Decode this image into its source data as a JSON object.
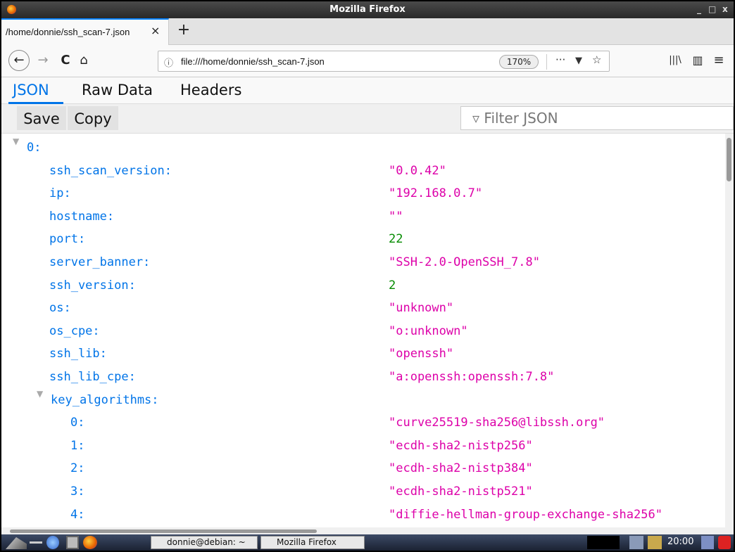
{
  "window": {
    "title": "Mozilla Firefox",
    "controls": [
      "_",
      "□",
      "x"
    ]
  },
  "tab": {
    "label": "/home/donnie/ssh_scan-7.json",
    "close": "×",
    "new_tab": "+"
  },
  "navbar": {
    "back": "←",
    "forward": "→",
    "reload": "C",
    "home": "⌂",
    "info_icon": "ⓘ",
    "url": "file:///home/donnie/ssh_scan-7.json",
    "zoom": "170%",
    "more": "···",
    "pocket": "▼",
    "bookmark": "☆",
    "library": "|||\\",
    "sidebar": "▥",
    "menu": "≡"
  },
  "viewer": {
    "tabs": [
      "JSON",
      "Raw Data",
      "Headers"
    ],
    "save": "Save",
    "copy": "Copy",
    "filter_placeholder": "▿ Filter JSON"
  },
  "json_rows": [
    {
      "key": "0:",
      "value": "",
      "type": "object",
      "expanded": true
    },
    {
      "key": "ssh_scan_version:",
      "value": "\"0.0.42\"",
      "type": "string"
    },
    {
      "key": "ip:",
      "value": "\"192.168.0.7\"",
      "type": "string"
    },
    {
      "key": "hostname:",
      "value": "\"\"",
      "type": "string"
    },
    {
      "key": "port:",
      "value": "22",
      "type": "number"
    },
    {
      "key": "server_banner:",
      "value": "\"SSH-2.0-OpenSSH_7.8\"",
      "type": "string"
    },
    {
      "key": "ssh_version:",
      "value": "2",
      "type": "number"
    },
    {
      "key": "os:",
      "value": "\"unknown\"",
      "type": "string"
    },
    {
      "key": "os_cpe:",
      "value": "\"o:unknown\"",
      "type": "string"
    },
    {
      "key": "ssh_lib:",
      "value": "\"openssh\"",
      "type": "string"
    },
    {
      "key": "ssh_lib_cpe:",
      "value": "\"a:openssh:openssh:7.8\"",
      "type": "string"
    },
    {
      "key": "key_algorithms:",
      "value": "",
      "type": "array",
      "expanded": true
    },
    {
      "key": "0:",
      "value": "\"curve25519-sha256@libssh.org\"",
      "type": "string"
    },
    {
      "key": "1:",
      "value": "\"ecdh-sha2-nistp256\"",
      "type": "string"
    },
    {
      "key": "2:",
      "value": "\"ecdh-sha2-nistp384\"",
      "type": "string"
    },
    {
      "key": "3:",
      "value": "\"ecdh-sha2-nistp521\"",
      "type": "string"
    },
    {
      "key": "4:",
      "value": "\"diffie-hellman-group-exchange-sha256\"",
      "type": "string"
    }
  ],
  "taskbar": {
    "tasks": [
      "donnie@debian: ~",
      "Mozilla Firefox"
    ],
    "clock": "20:00"
  },
  "colors": {
    "key": "#0074e8",
    "string": "#dd00a9",
    "number": "#058b00",
    "accent": "#0a84ff"
  }
}
